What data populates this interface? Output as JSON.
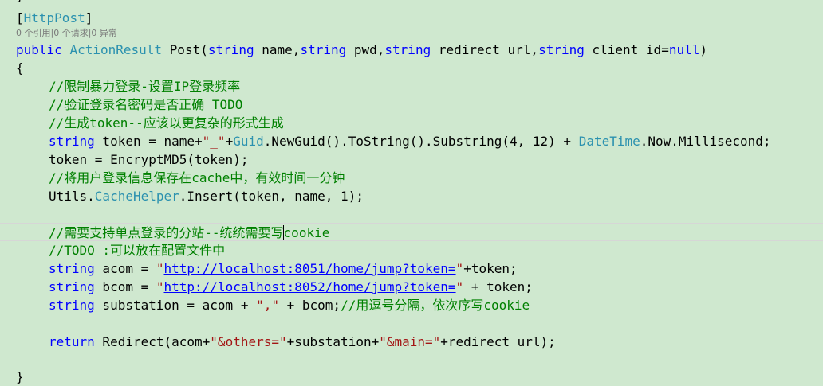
{
  "editor": {
    "prev_line_tail": "}",
    "attr_open": "[",
    "attr_name": "HttpPost",
    "attr_close": "]",
    "codelens": "0 个引用|0 个请求|0 异常",
    "sig": {
      "public": "public",
      "sp1": " ",
      "return_type": "ActionResult",
      "sp2": " ",
      "method": "Post(",
      "t1": "string",
      "p1": " name,",
      "t2": "string",
      "p2": " pwd,",
      "t3": "string",
      "p3": " redirect_url,",
      "t4": "string",
      "p4": " client_id=",
      "null": "null",
      "close": ")"
    },
    "open_brace": "{",
    "c1": "//限制暴力登录-设置IP登录频率",
    "c2": "//验证登录名密码是否正确 TODO",
    "c3": "//生成token--应该以更复杂的形式生成",
    "l_token": {
      "kw": "string",
      "a": " token = name+",
      "s": "\"_\"",
      "b": "+",
      "guid": "Guid",
      "c": ".NewGuid().ToString().Substring(4, 12) + ",
      "dt": "DateTime",
      "d": ".Now.Millisecond;"
    },
    "l_encrypt": "token = EncryptMD5(token);",
    "c4": "//将用户登录信息保存在cache中，有效时间一分钟",
    "l_cache": {
      "a": "Utils.",
      "helper": "CacheHelper",
      "b": ".Insert(token, name, 1);"
    },
    "c5_before_caret": "//需要支持单点登录的分站--统统需要写",
    "c5_after_caret": "cookie",
    "c6": "//TODO :可以放在配置文件中",
    "l_acom": {
      "kw": "string",
      "a": " acom = ",
      "q1": "\"",
      "url": "http://localhost:8051/home/jump?token=",
      "q2": "\"",
      "b": "+token;"
    },
    "l_bcom": {
      "kw": "string",
      "a": " bcom = ",
      "q1": "\"",
      "url": "http://localhost:8052/home/jump?token=",
      "q2": "\"",
      "b": " + token;"
    },
    "l_sub": {
      "kw": "string",
      "a": " substation = acom + ",
      "s": "\",\"",
      "b": " + bcom;",
      "cm": "//用逗号分隔，依次序写cookie"
    },
    "l_ret": {
      "kw": "return",
      "a": " Redirect(acom+",
      "s1": "\"&others=\"",
      "b": "+substation+",
      "s2": "\"&main=\"",
      "c": "+redirect_url);"
    },
    "close_brace": "}"
  },
  "colors": {
    "background": "#cfe8cf",
    "keyword": "#0000ff",
    "type": "#2b91af",
    "comment": "#008000",
    "string": "#a31515"
  }
}
